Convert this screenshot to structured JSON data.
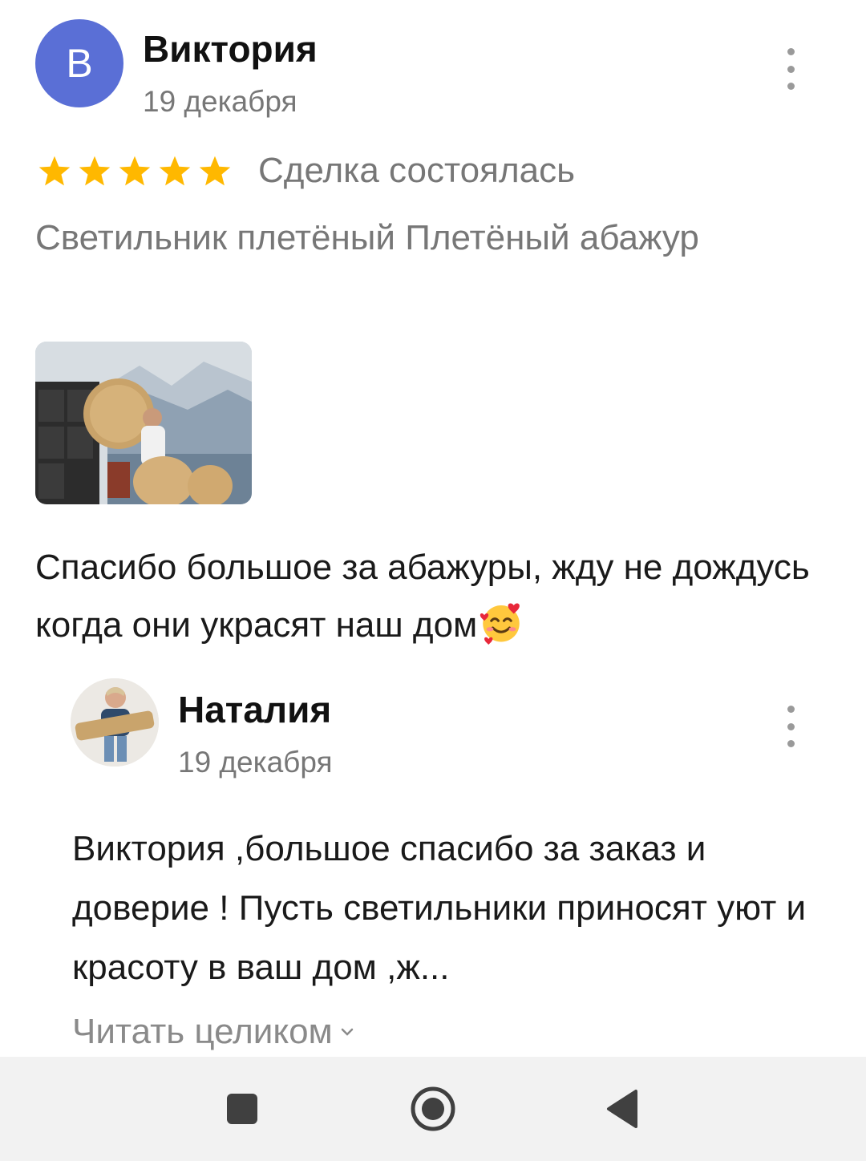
{
  "review": {
    "avatar_letter": "В",
    "author": "Виктория",
    "date": "19 декабря",
    "rating": 5,
    "deal_status": "Сделка состоялась",
    "product_title": "Светильник плетёный Плетёный абажур",
    "text": "Спасибо большое за абажуры, жду не дождусь когда они украсят наш дом",
    "emoji": "smiling-face-with-hearts"
  },
  "reply": {
    "author": "Наталия",
    "date": "19 декабря",
    "text": "Виктория ,большое спасибо за заказ и доверие ! Пусть светильники приносят  уют и красоту в ваш дом ,ж...",
    "read_more": "Читать целиком"
  },
  "colors": {
    "avatar_bg": "#5a6fd6",
    "star": "#ffb800",
    "secondary_text": "#777777",
    "navbar_bg": "#f2f2f2"
  },
  "navbar": {
    "buttons": [
      "recent-apps-icon",
      "home-icon",
      "back-icon"
    ]
  }
}
